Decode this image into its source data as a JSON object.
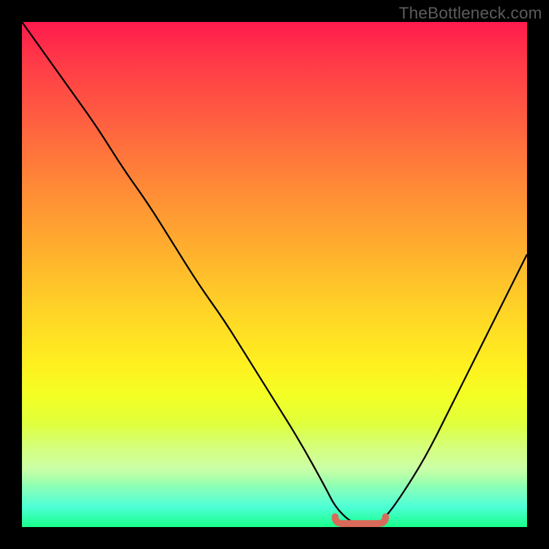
{
  "watermark": "TheBottleneck.com",
  "colors": {
    "background": "#000000",
    "curve": "#000000",
    "marker": "#d86a5a",
    "gradient_top": "#ff1a4d",
    "gradient_bottom": "#1aff8a"
  },
  "chart_data": {
    "type": "line",
    "title": "",
    "xlabel": "",
    "ylabel": "",
    "xlim": [
      0,
      100
    ],
    "ylim": [
      0,
      100
    ],
    "background": "red-to-green vertical spectrum gradient",
    "x": [
      0,
      5,
      10,
      15,
      20,
      25,
      30,
      35,
      40,
      45,
      50,
      55,
      60,
      62,
      65,
      68,
      70,
      72,
      75,
      80,
      85,
      90,
      95,
      100
    ],
    "y": [
      100,
      93,
      86,
      79,
      71,
      64,
      56,
      48,
      41,
      33,
      25,
      17,
      8,
      4,
      1,
      0,
      0,
      2,
      6,
      14,
      24,
      34,
      44,
      54
    ],
    "marker_segment": {
      "x_start": 62,
      "x_end": 72,
      "y": 0
    },
    "notes": "V-shaped black curve over a rainbow gradient; small salmon U-shaped marker at the valley bottom. Axes and ticks are not visible (plot framed by solid black border)."
  }
}
